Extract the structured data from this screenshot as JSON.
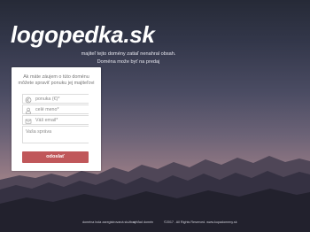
{
  "site": {
    "domain": "logopedka.sk",
    "tagline_1": "majiteľ tejto domény zatiaľ nenahral obsah.",
    "tagline_2": "Doména može byť na predaj"
  },
  "offer_form": {
    "intro": "Ak máte záujem o túto doménu môžete spraviť ponuku jej majiteľovi",
    "fields": [
      {
        "placeholder": "ponuka (€)*",
        "icon": "money-icon"
      },
      {
        "placeholder": "celé meno*",
        "icon": "user-icon"
      },
      {
        "placeholder": "Váš email*",
        "icon": "envelope-icon"
      }
    ],
    "message_placeholder": "Vaša správa",
    "submit_label": "odoslať"
  },
  "footer": {
    "link_1": "doména bola zaregistrovaná službou",
    "link_2": "výhľad domén",
    "copyright": "©2017 . All Rights Reserved. www.kupadomeny.sk"
  },
  "colors": {
    "button": "#c0575a",
    "text_white": "#ffffff"
  }
}
